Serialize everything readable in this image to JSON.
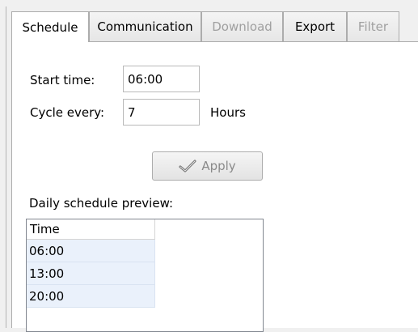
{
  "tabs": [
    {
      "label": "Schedule",
      "state": "active"
    },
    {
      "label": "Communication",
      "state": "enabled"
    },
    {
      "label": "Download",
      "state": "disabled"
    },
    {
      "label": "Export",
      "state": "enabled"
    },
    {
      "label": "Filter",
      "state": "disabled"
    }
  ],
  "schedule": {
    "start_time_label": "Start time:",
    "start_time_value": "06:00",
    "cycle_label": "Cycle every:",
    "cycle_value": "7",
    "cycle_unit": "Hours",
    "apply_label": "Apply",
    "apply_icon": "checkmark-icon",
    "apply_enabled": false,
    "preview_label": "Daily schedule preview:",
    "preview": {
      "column_header": "Time",
      "rows": [
        "06:00",
        "13:00",
        "20:00"
      ]
    }
  },
  "colors": {
    "disabled_text": "#a0a0a0",
    "row_highlight": "#eaf1fb"
  }
}
